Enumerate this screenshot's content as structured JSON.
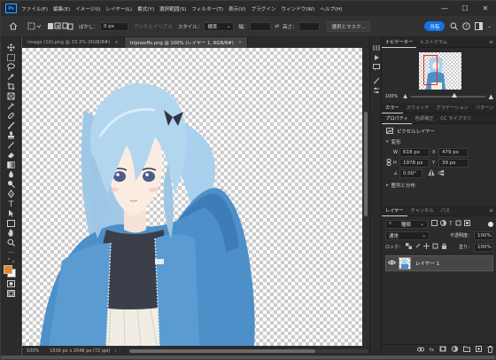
{
  "app": {
    "logo_text": "Ps"
  },
  "menu": {
    "items": [
      "ファイル(F)",
      "編集(E)",
      "イメージ(I)",
      "レイヤー(L)",
      "書式(Y)",
      "選択範囲(S)",
      "フィルター(T)",
      "表示(V)",
      "プラグイン",
      "ウィンドウ(W)",
      "ヘルプ(H)"
    ]
  },
  "window_controls": {
    "minimize": "—",
    "maximize": "☐",
    "close": "✕"
  },
  "options": {
    "feather_label": "ぼかし：",
    "feather_value": "0 px",
    "antialias_label": "アンチエイリアス",
    "style_label": "スタイル：",
    "style_value": "標準",
    "width_label": "幅：",
    "height_label": "高さ：",
    "select_mask": "選択とマスク...",
    "share": "共有"
  },
  "tabs": [
    {
      "label": "image (10).png @ 33.3% (RGB/8#)",
      "close": "×"
    },
    {
      "label": "tripnoeffs.png @ 100% (レイヤー 1, RGB/8#)",
      "close": "×"
    }
  ],
  "status": {
    "zoom": "100%",
    "dimensions": "1536 px x 2048 px (72 ppi)",
    "arrow": "›"
  },
  "navigator": {
    "tabs": [
      "ナビゲーター",
      "ヒストグラム"
    ],
    "zoom": "100%"
  },
  "color_tabs": [
    "カラー",
    "スウォッチ",
    "グラデーション",
    "パターン"
  ],
  "properties": {
    "tabs": [
      "プロパティ",
      "色調補正",
      "CC ライブラリ"
    ],
    "layer_type": "ピクセルレイヤー",
    "transform_heading": "変形",
    "w_label": "W",
    "w_value": "618 px",
    "x_label": "X",
    "x_value": "479 px",
    "h_label": "H",
    "h_value": "1978 px",
    "y_label": "Y",
    "y_value": "39 px",
    "angle_value": "0.00°",
    "align_heading": "整列と分布"
  },
  "layers": {
    "tabs": [
      "レイヤー",
      "チャンネル",
      "パス"
    ],
    "filter_label": "種類",
    "blend_mode": "通常",
    "opacity_label": "不透明度：",
    "opacity_value": "100%",
    "lock_label": "ロック：",
    "fill_label": "塗り：",
    "fill_value": "100%",
    "items": [
      {
        "name": "レイヤー 1"
      }
    ],
    "footer_icons": [
      "link-icon",
      "fx-icon",
      "mask-icon",
      "adjustment-icon",
      "folder-icon",
      "new-layer-icon",
      "trash-icon"
    ]
  },
  "colors": {
    "accent": "#31a8ff",
    "share_button": "#1473e6",
    "foreground": "#e8862a",
    "background_swatch": "#ffffff",
    "panel_bg": "#2b2b2b",
    "workspace_bg": "#535353"
  }
}
